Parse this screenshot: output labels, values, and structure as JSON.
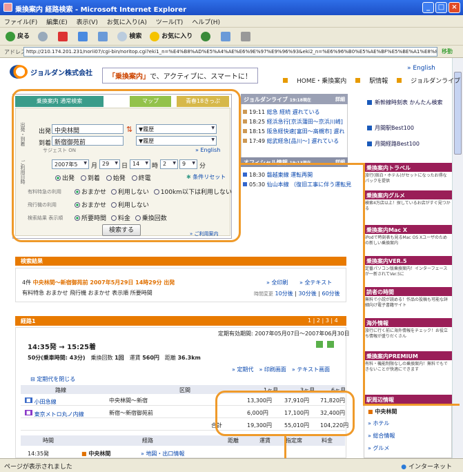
{
  "window": {
    "title": "乗換案内 経路検索 - Microsoft Internet Explorer"
  },
  "menu": [
    "ファイル(F)",
    "編集(E)",
    "表示(V)",
    "お気に入り(A)",
    "ツール(T)",
    "ヘルプ(H)"
  ],
  "toolbar": {
    "back": "戻る",
    "search": "検索",
    "favorites": "お気に入り"
  },
  "address": {
    "label": "アドレス(D)",
    "url": "http://210.174.201.231/norii07/cgi-bin/noritop.cgi?eki1_n=%E4%B8%AD%E5%A4%AE%E6%9E%97%E9%96%93&eki2_n=%E6%96%B0%E5%AE%BF%E5%BE%A1%E8%8B%91%E5%89%8D",
    "go": "移動"
  },
  "header": {
    "company": "ジョルダン株式会社",
    "tagline_highlight": "「乗換案内」",
    "tagline_rest": "で、アクティブに、スマートに！",
    "english": "» English",
    "nav": [
      "HOME・乗換案内",
      "駅情報",
      "ジョルダンライブ"
    ]
  },
  "search": {
    "tabs": [
      "乗換案内 通常検索",
      "マップ",
      "青春18きっぷ"
    ],
    "side_from": "出発・到着",
    "side_date": "ご利用日時",
    "from_label": "出発",
    "from_value": "中央林間",
    "to_label": "到着",
    "to_value": "新宿御苑前",
    "history": "▼履歴",
    "suggest": "サジェスト ON",
    "english": "» English",
    "year": "2007年5",
    "year_unit": "月",
    "day": "29",
    "day_unit": "日",
    "hour": "14",
    "hour_unit": "時",
    "min1": "2",
    "min2": "9",
    "min_unit": "分",
    "time_opts": [
      "出発",
      "到着",
      "始発",
      "終電"
    ],
    "reset": "条件リセット",
    "express_label": "有料特急の利用",
    "express_opts": [
      "おまかせ",
      "利用しない",
      "100km以下は利用しない"
    ],
    "plane_label": "飛行機の利用",
    "plane_opts": [
      "おまかせ",
      "利用しない"
    ],
    "sort_label": "検索結果 表示順",
    "sort_opts": [
      "所要時間",
      "料金",
      "乗換回数"
    ],
    "submit": "検索する",
    "help": "» ご利用案内"
  },
  "live": {
    "title": "ジョルダンライブ",
    "stamp": "19:18現在",
    "more": "詳細",
    "items": [
      {
        "time": "19:11",
        "text": "総急 経続 遅れている"
      },
      {
        "time": "18:25",
        "text": "経浜急行[京浜蒲田～京浜川崎]"
      },
      {
        "time": "18:15",
        "text": "阪急経快速[富田～高槻市] 遅れ"
      },
      {
        "time": "17:49",
        "text": "総武経急[品川～] 遅れている"
      }
    ]
  },
  "official": {
    "title": "オフィシャル情報",
    "stamp": "19:13現在",
    "more": "詳細",
    "items": [
      {
        "time": "18:30",
        "text": "磐越東線 運転再開"
      },
      {
        "time": "05:30",
        "text": "仙山本線 （復旧工事に伴う運転見"
      }
    ]
  },
  "right_links": [
    "新幹線時刻表 かんたん検索",
    "月間駅Best100",
    "月間経路Best100"
  ],
  "ads": [
    {
      "head": "乗換案内トラベル",
      "text": "旅行(宿泊・ホテル)がセットになったお得なパックを提供"
    },
    {
      "head": "乗換案内グルメ",
      "text": "検索4万店以上！探しているお店がすぐ見つかる"
    },
    {
      "head": "乗換案内Mac X",
      "text": "iPodで時刻表も見るMac OS Xユーザのための新しい乗換案内"
    },
    {
      "head": "乗換案内VER.5",
      "text": "定番パソコン版乗換案内！インターフェースが一新されてVer.5に"
    },
    {
      "head": "読者の時間",
      "text": "無料で小説が読める！作品の投稿も可能な詳細向け電子書籍サイト"
    },
    {
      "head": "海外情報",
      "text": "旅行に行く前に海外情報をチェック！お役立ち情報が盛りだくさん"
    },
    {
      "head": "乗換案内PREMIUM",
      "text": "有料・機能制限なしの乗換案内！無料でもできないことが快適にできます"
    }
  ],
  "station_panel": {
    "title": "駅周辺情報",
    "station": "中央林間",
    "items": [
      "ホテル",
      "総合情報",
      "グルメ"
    ]
  },
  "results": {
    "header": "検索結果",
    "count": "4件",
    "route_title": "中央林間～新宿御苑前 2007年5月29日 14時29分 出発",
    "sort_info": "有料特急 おまかせ 飛行機 おまかせ 表示順 所要時間",
    "all_routes": "» 全印刷",
    "all_text": "» 全テキスト",
    "timing_label": "時間変更",
    "timing": [
      "10分後",
      "30分後",
      "60分後"
    ]
  },
  "route": {
    "label": "経路1",
    "pages": [
      "1",
      "2",
      "3",
      "4"
    ],
    "validity": "定期有効期間: 2007年05月07日～2007年06月30日",
    "depart_arrive": "14:35発 → 15:25着",
    "duration": "50分(乗車時間: 43分)",
    "transfers": "1回",
    "fare": "560円",
    "distance": "36.3km",
    "links": [
      "» 定期代",
      "» 印刷画面",
      "» テキスト画面"
    ],
    "hide_label": "定期代を閉じる",
    "cols": [
      "路線",
      "区間",
      "1ヶ月",
      "3ヶ月",
      "6ヶ月"
    ],
    "rows": [
      {
        "line": "小田急線",
        "section": "中央林間～新宿",
        "m1": "13,300円",
        "m3": "37,910円",
        "m6": "71,820円"
      },
      {
        "line": "東京メトロ丸ノ内線",
        "section": "新宿～新宿御苑前",
        "m1": "6,000円",
        "m3": "17,100円",
        "m6": "32,400円"
      }
    ],
    "total_label": "合計",
    "total": {
      "m1": "19,300円",
      "m3": "55,010円",
      "m6": "104,220円"
    },
    "detail_cols": [
      "時間",
      "経路",
      "距離",
      "運賃",
      "指定席",
      "料金"
    ],
    "first_time": "14:35発",
    "first_station": "中央林間",
    "first_links": "» 地図・出口情報"
  },
  "status": {
    "left": "ページが表示されました",
    "right": "インターネット"
  }
}
